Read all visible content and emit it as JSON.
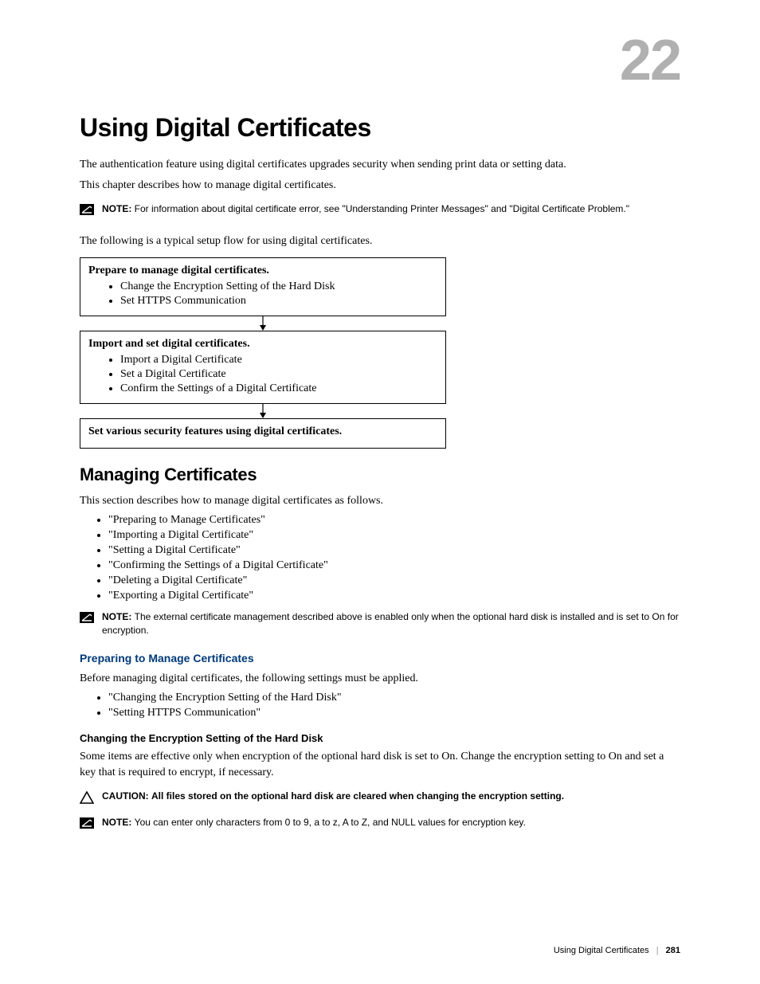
{
  "chapter_number": "22",
  "title": "Using Digital Certificates",
  "intro_p1": "The authentication feature using digital certificates upgrades security when sending print data or setting data.",
  "intro_p2": "This chapter describes how to manage digital certificates.",
  "note1": {
    "label": "NOTE: ",
    "text": "For information about digital certificate error, see \"Understanding Printer Messages\" and \"Digital Certificate Problem.\""
  },
  "flow_intro": "The following is a typical setup flow for using digital certificates.",
  "flow": {
    "box1": {
      "title": "Prepare to manage digital certificates.",
      "items": [
        "Change the Encryption Setting of the Hard Disk",
        "Set HTTPS Communication"
      ]
    },
    "box2": {
      "title": "Import and set digital certificates.",
      "items": [
        "Import a Digital Certificate",
        "Set a Digital Certificate",
        "Confirm the Settings of a Digital Certificate"
      ]
    },
    "box3": {
      "title": "Set various security features using digital certificates."
    }
  },
  "section": {
    "heading": "Managing Certificates",
    "intro": "This section describes how to manage digital certificates as follows.",
    "items": [
      "\"Preparing to Manage Certificates\"",
      "\"Importing a Digital Certificate\"",
      "\"Setting a Digital Certificate\"",
      "\"Confirming the Settings of a Digital Certificate\"",
      "\"Deleting a Digital Certificate\"",
      "\"Exporting a Digital Certificate\""
    ]
  },
  "note2": {
    "label": "NOTE: ",
    "text": "The external certificate management described above is enabled only when the optional hard disk is installed and is set to On for encryption."
  },
  "sub1": {
    "heading": "Preparing to Manage Certificates",
    "intro": "Before managing digital certificates, the following settings must be applied.",
    "items": [
      "\"Changing the Encryption Setting of the Hard Disk\"",
      "\"Setting HTTPS Communication\""
    ]
  },
  "sub2": {
    "heading": "Changing the Encryption Setting of the Hard Disk",
    "body": "Some items are effective only when encryption of the optional hard disk is set to On. Change the encryption setting to On and set a key that is required to encrypt, if necessary."
  },
  "caution1": {
    "label": "CAUTION: ",
    "text": "All files stored on the optional hard disk are cleared when changing the encryption setting."
  },
  "note3": {
    "label": "NOTE: ",
    "text": "You can enter only characters from 0 to 9, a to z, A to Z, and NULL values for encryption key."
  },
  "footer": {
    "title": "Using Digital Certificates",
    "page": "281"
  }
}
